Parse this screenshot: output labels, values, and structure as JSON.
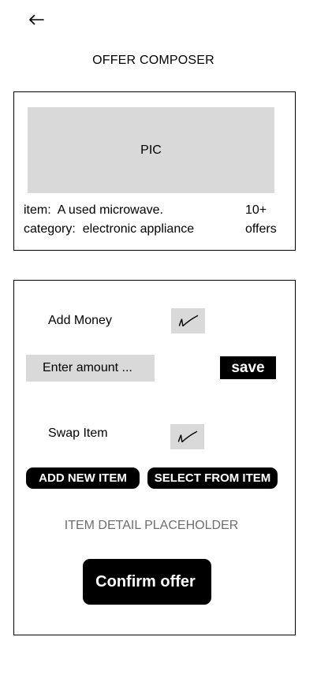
{
  "header": {
    "back_icon": "arrow-left-icon",
    "title": "OFFER COMPOSER"
  },
  "listing": {
    "pic_label": "PIC",
    "item_label": "item:",
    "item_value": "A used microwave.",
    "category_label": "category:",
    "category_value": "electronic appliance",
    "offers_count": "10+",
    "offers_label": "offers"
  },
  "offer": {
    "add_money_label": "Add Money",
    "add_money_checked": true,
    "amount_placeholder": "Enter amount ...",
    "save_label": "save",
    "swap_item_label": "Swap Item",
    "swap_item_checked": true,
    "add_new_item_label": "ADD NEW ITEM",
    "select_from_item_label": "SELECT FROM ITEM",
    "item_detail_placeholder": "ITEM DETAIL PLACEHOLDER",
    "confirm_label": "Confirm offer"
  },
  "colors": {
    "placeholder_gray": "#d9d9d9",
    "button_black": "#000000",
    "muted_text": "#6e6e6e"
  }
}
